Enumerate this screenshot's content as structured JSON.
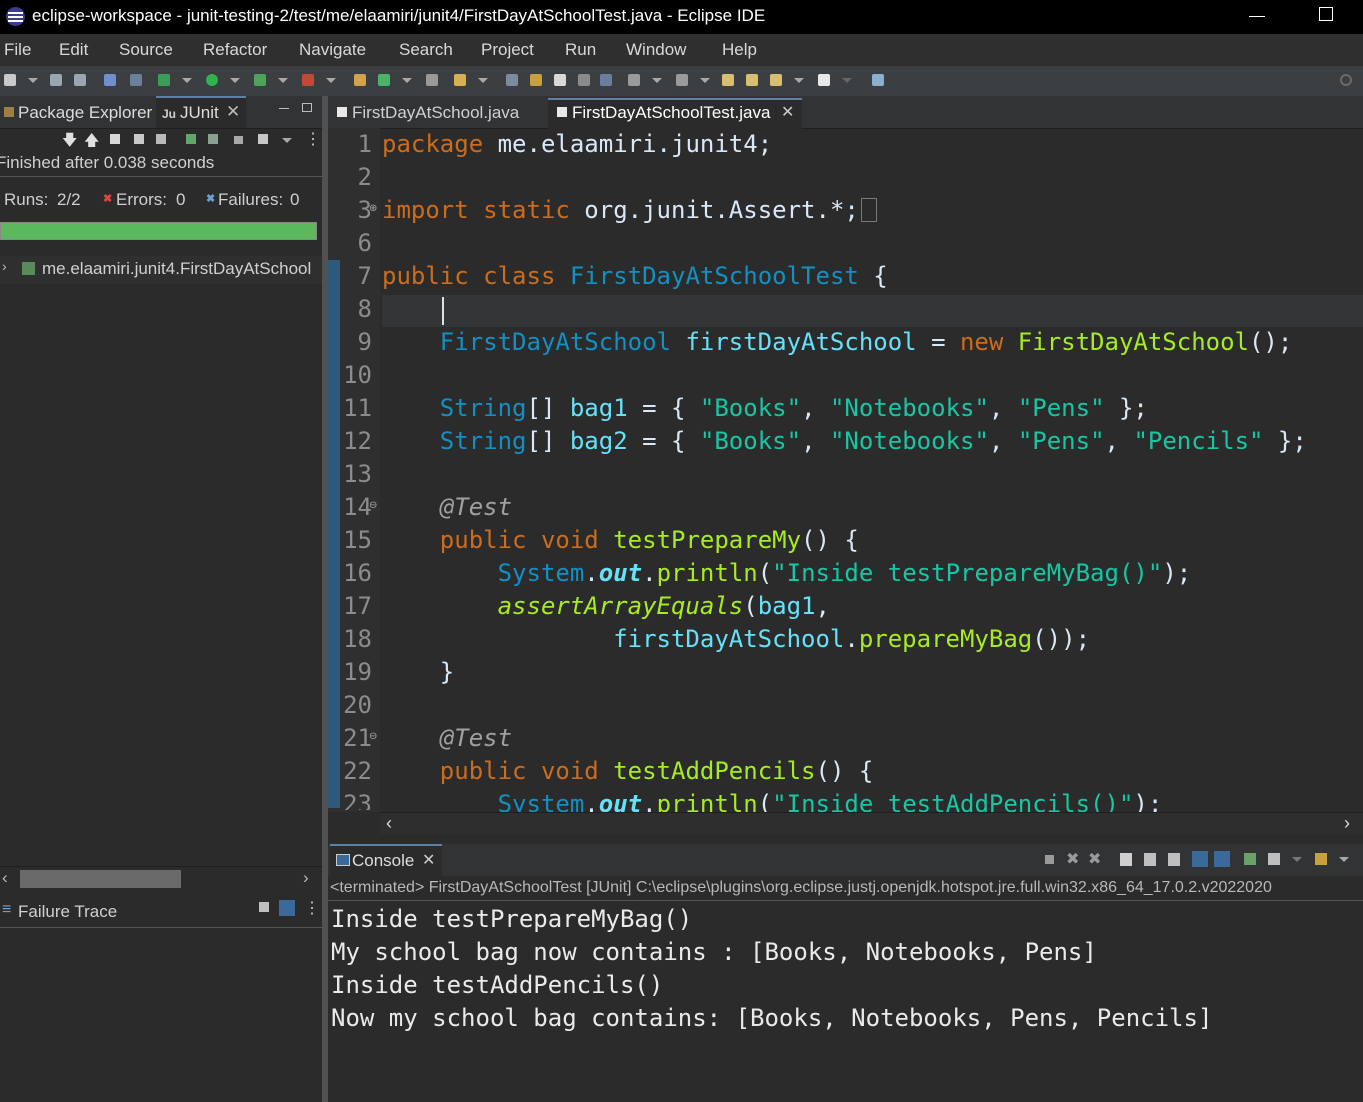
{
  "window": {
    "title": "eclipse-workspace - junit-testing-2/test/me/elaamiri/junit4/FirstDayAtSchoolTest.java - Eclipse IDE"
  },
  "menu": [
    "File",
    "Edit",
    "Source",
    "Refactor",
    "Navigate",
    "Search",
    "Project",
    "Run",
    "Window",
    "Help"
  ],
  "left_views": {
    "tabs": [
      "Package Explorer",
      "JUnit"
    ],
    "junit": {
      "status": "Finished after 0.038 seconds",
      "runs_label": "Runs:",
      "runs_value": "2/2",
      "errors_label": "Errors:",
      "errors_value": "0",
      "failures_label": "Failures:",
      "failures_value": "0",
      "progress_fraction": 1.0,
      "progress_color": "#5cb85c",
      "tree_item": "me.elaamiri.junit4.FirstDayAtSchool",
      "failure_trace_label": "Failure Trace"
    }
  },
  "editor": {
    "tabs": [
      "FirstDayAtSchool.java",
      "FirstDayAtSchoolTest.java"
    ],
    "active_tab": "FirstDayAtSchoolTest.java",
    "line_numbers": [
      "1",
      "2",
      "3",
      "6",
      "7",
      "8",
      "9",
      "10",
      "11",
      "12",
      "13",
      "14",
      "15",
      "16",
      "17",
      "18",
      "19",
      "20",
      "21",
      "22",
      "23"
    ],
    "code_lines": [
      "package me.elaamiri.junit4;",
      "",
      "import static org.junit.Assert.*;",
      "",
      "public class FirstDayAtSchoolTest {",
      "",
      "    FirstDayAtSchool firstDayAtSchool = new FirstDayAtSchool();",
      "",
      "    String[] bag1 = { \"Books\", \"Notebooks\", \"Pens\" };",
      "    String[] bag2 = { \"Books\", \"Notebooks\", \"Pens\", \"Pencils\" };",
      "",
      "    @Test",
      "    public void testPrepareMy() {",
      "        System.out.println(\"Inside testPrepareMyBag()\");",
      "        assertArrayEquals(bag1,",
      "                firstDayAtSchool.prepareMyBag());",
      "    }",
      "",
      "    @Test",
      "    public void testAddPencils() {",
      "        System.out.println(\"Inside testAddPencils()\");"
    ]
  },
  "console": {
    "tab": "Console",
    "header": "<terminated> FirstDayAtSchoolTest [JUnit] C:\\eclipse\\plugins\\org.eclipse.justj.openjdk.hotspot.jre.full.win32.x86_64_17.0.2.v2022020",
    "output": [
      "Inside testPrepareMyBag()",
      "My school bag now contains : [Books, Notebooks, Pens]",
      "Inside testAddPencils()",
      "Now my school bag contains: [Books, Notebooks, Pens, Pencils]"
    ]
  },
  "icons": [
    "eclipse-logo-icon",
    "minimize-icon",
    "maximize-icon",
    "package-explorer-icon",
    "junit-icon",
    "close-icon",
    "test-suite-icon",
    "failure-trace-icon",
    "console-icon",
    "java-file-icon"
  ]
}
